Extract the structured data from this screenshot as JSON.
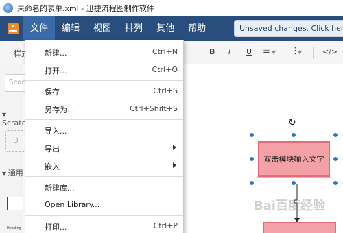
{
  "window": {
    "title": "未命名的表单.xml - 迅捷流程图制作软件"
  },
  "menubar": {
    "items": [
      "文件",
      "编辑",
      "视图",
      "排列",
      "其他",
      "帮助"
    ],
    "unsaved_notice": "Unsaved changes. Click here to save."
  },
  "toolbar": {
    "style_label": "样式",
    "bold": "B",
    "italic": "I",
    "underline": "U",
    "align": "≡",
    "more": "⋮",
    "html": "</>"
  },
  "left_panel": {
    "search_placeholder": "Search",
    "scratchpad_label": "Scratchpad",
    "scratch_hint": "D",
    "general_label": "通用",
    "heading_mini": "Heading"
  },
  "file_menu": {
    "items": [
      {
        "label": "新建...",
        "shortcut": "Ctrl+N"
      },
      {
        "label": "打开...",
        "shortcut": "Ctrl+O"
      },
      {
        "label": "保存",
        "shortcut": "Ctrl+S"
      },
      {
        "label": "另存为...",
        "shortcut": "Ctrl+Shift+S"
      },
      {
        "label": "导入...",
        "shortcut": ""
      },
      {
        "label": "导出",
        "shortcut": ""
      },
      {
        "label": "嵌入",
        "shortcut": ""
      },
      {
        "label": "新建库...",
        "shortcut": ""
      },
      {
        "label": "Open Library...",
        "shortcut": ""
      },
      {
        "label": "打印...",
        "shortcut": "Ctrl+P"
      }
    ]
  },
  "canvas": {
    "shape_text": "双击模块输入文字",
    "watermark": "Bai百度经验"
  },
  "colors": {
    "menubar_bg": "#294d7d",
    "menu_active": "#3a6aa8",
    "shape_fill": "#f4a1a6",
    "shape_border": "#e26c78",
    "handle": "#2a76d2"
  }
}
